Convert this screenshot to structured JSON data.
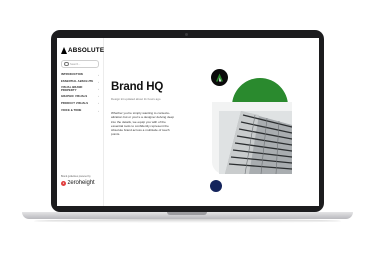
{
  "brand": {
    "logo_text": "ABSOLUTE"
  },
  "search": {
    "placeholder": "Search..."
  },
  "nav": {
    "items": [
      {
        "label": "INTRODUCTION"
      },
      {
        "label": "ESSENTIAL ABSOLUTE"
      },
      {
        "label": "VISUAL BRAND PROPERTY"
      },
      {
        "label": "GRAPHIC VISUALS"
      },
      {
        "label": "PRODUCT VISUALS"
      },
      {
        "label": "VOICE & TONE"
      }
    ]
  },
  "footer": {
    "caption": "Brand guidelines powered by",
    "vendor": "zeroheight"
  },
  "main": {
    "title": "Brand HQ",
    "updated": "Design kit updated about 11 hours ago",
    "body": "Whether you're simply wanting to contextu- alization but or you're a designer delving deep into the details, we equip you with of the essential tools to confidently represent the Absolute brand across a multitude of touch points."
  },
  "colors": {
    "green": "#2a8a2e",
    "navy": "#14245c",
    "black": "#0a0a0a"
  }
}
